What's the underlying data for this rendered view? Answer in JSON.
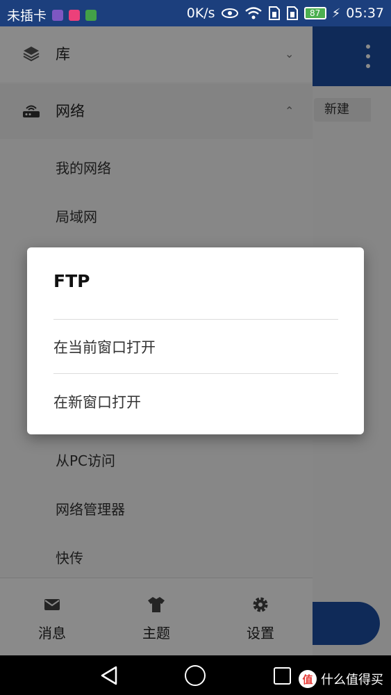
{
  "status_bar": {
    "carrier": "未插卡",
    "speed": "0K/s",
    "battery": "87",
    "time": "05:37",
    "icons": [
      "gallery-app-icon",
      "photo-app-icon",
      "app-icon",
      "eye-icon",
      "wifi-icon",
      "sim-1-icon",
      "sim-2-icon",
      "battery-icon",
      "charging-icon"
    ]
  },
  "app": {
    "new_chip": "新建",
    "header_color": "#1c4fa3"
  },
  "drawer": {
    "sections": [
      {
        "label": "库",
        "icon": "layers-icon",
        "chevron": "chevron-down-icon"
      },
      {
        "label": "网络",
        "icon": "router-icon",
        "chevron": "chevron-up-icon"
      }
    ],
    "network_items": [
      "我的网络",
      "局域网",
      "从PC访问",
      "网络管理器",
      "快传"
    ],
    "bottom_nav": [
      {
        "label": "消息",
        "icon": "mail-icon"
      },
      {
        "label": "主题",
        "icon": "tshirt-icon"
      },
      {
        "label": "设置",
        "icon": "gear-icon"
      }
    ]
  },
  "dialog": {
    "title": "FTP",
    "options": [
      "在当前窗口打开",
      "在新窗口打开"
    ]
  },
  "nav_bar": {
    "icons": [
      "back-icon",
      "home-icon",
      "recent-apps-icon"
    ],
    "watermark_logo": "值",
    "watermark_text": "什么值得买"
  }
}
